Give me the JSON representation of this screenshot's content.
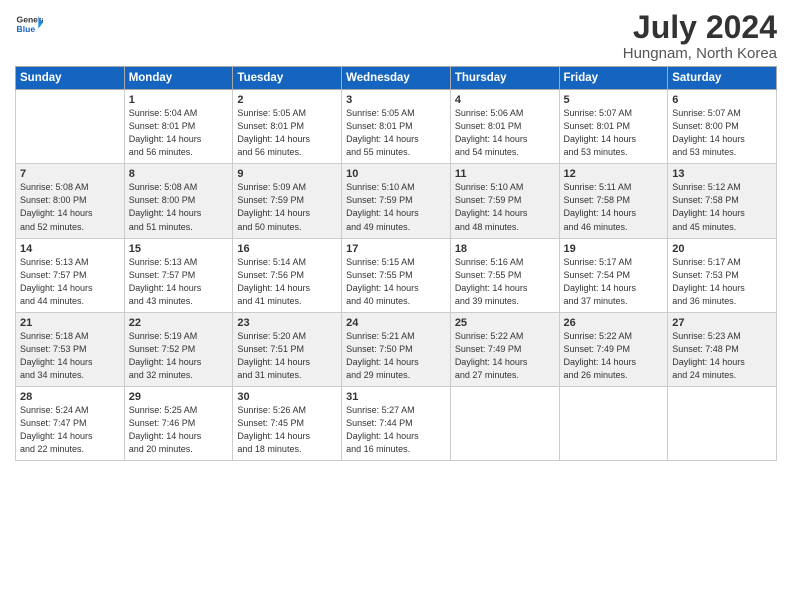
{
  "header": {
    "logo_general": "General",
    "logo_blue": "Blue",
    "title": "July 2024",
    "subtitle": "Hungnam, North Korea"
  },
  "days_of_week": [
    "Sunday",
    "Monday",
    "Tuesday",
    "Wednesday",
    "Thursday",
    "Friday",
    "Saturday"
  ],
  "weeks": [
    [
      {
        "day": "",
        "info": ""
      },
      {
        "day": "1",
        "info": "Sunrise: 5:04 AM\nSunset: 8:01 PM\nDaylight: 14 hours\nand 56 minutes."
      },
      {
        "day": "2",
        "info": "Sunrise: 5:05 AM\nSunset: 8:01 PM\nDaylight: 14 hours\nand 56 minutes."
      },
      {
        "day": "3",
        "info": "Sunrise: 5:05 AM\nSunset: 8:01 PM\nDaylight: 14 hours\nand 55 minutes."
      },
      {
        "day": "4",
        "info": "Sunrise: 5:06 AM\nSunset: 8:01 PM\nDaylight: 14 hours\nand 54 minutes."
      },
      {
        "day": "5",
        "info": "Sunrise: 5:07 AM\nSunset: 8:01 PM\nDaylight: 14 hours\nand 53 minutes."
      },
      {
        "day": "6",
        "info": "Sunrise: 5:07 AM\nSunset: 8:00 PM\nDaylight: 14 hours\nand 53 minutes."
      }
    ],
    [
      {
        "day": "7",
        "info": "Sunrise: 5:08 AM\nSunset: 8:00 PM\nDaylight: 14 hours\nand 52 minutes."
      },
      {
        "day": "8",
        "info": "Sunrise: 5:08 AM\nSunset: 8:00 PM\nDaylight: 14 hours\nand 51 minutes."
      },
      {
        "day": "9",
        "info": "Sunrise: 5:09 AM\nSunset: 7:59 PM\nDaylight: 14 hours\nand 50 minutes."
      },
      {
        "day": "10",
        "info": "Sunrise: 5:10 AM\nSunset: 7:59 PM\nDaylight: 14 hours\nand 49 minutes."
      },
      {
        "day": "11",
        "info": "Sunrise: 5:10 AM\nSunset: 7:59 PM\nDaylight: 14 hours\nand 48 minutes."
      },
      {
        "day": "12",
        "info": "Sunrise: 5:11 AM\nSunset: 7:58 PM\nDaylight: 14 hours\nand 46 minutes."
      },
      {
        "day": "13",
        "info": "Sunrise: 5:12 AM\nSunset: 7:58 PM\nDaylight: 14 hours\nand 45 minutes."
      }
    ],
    [
      {
        "day": "14",
        "info": "Sunrise: 5:13 AM\nSunset: 7:57 PM\nDaylight: 14 hours\nand 44 minutes."
      },
      {
        "day": "15",
        "info": "Sunrise: 5:13 AM\nSunset: 7:57 PM\nDaylight: 14 hours\nand 43 minutes."
      },
      {
        "day": "16",
        "info": "Sunrise: 5:14 AM\nSunset: 7:56 PM\nDaylight: 14 hours\nand 41 minutes."
      },
      {
        "day": "17",
        "info": "Sunrise: 5:15 AM\nSunset: 7:55 PM\nDaylight: 14 hours\nand 40 minutes."
      },
      {
        "day": "18",
        "info": "Sunrise: 5:16 AM\nSunset: 7:55 PM\nDaylight: 14 hours\nand 39 minutes."
      },
      {
        "day": "19",
        "info": "Sunrise: 5:17 AM\nSunset: 7:54 PM\nDaylight: 14 hours\nand 37 minutes."
      },
      {
        "day": "20",
        "info": "Sunrise: 5:17 AM\nSunset: 7:53 PM\nDaylight: 14 hours\nand 36 minutes."
      }
    ],
    [
      {
        "day": "21",
        "info": "Sunrise: 5:18 AM\nSunset: 7:53 PM\nDaylight: 14 hours\nand 34 minutes."
      },
      {
        "day": "22",
        "info": "Sunrise: 5:19 AM\nSunset: 7:52 PM\nDaylight: 14 hours\nand 32 minutes."
      },
      {
        "day": "23",
        "info": "Sunrise: 5:20 AM\nSunset: 7:51 PM\nDaylight: 14 hours\nand 31 minutes."
      },
      {
        "day": "24",
        "info": "Sunrise: 5:21 AM\nSunset: 7:50 PM\nDaylight: 14 hours\nand 29 minutes."
      },
      {
        "day": "25",
        "info": "Sunrise: 5:22 AM\nSunset: 7:49 PM\nDaylight: 14 hours\nand 27 minutes."
      },
      {
        "day": "26",
        "info": "Sunrise: 5:22 AM\nSunset: 7:49 PM\nDaylight: 14 hours\nand 26 minutes."
      },
      {
        "day": "27",
        "info": "Sunrise: 5:23 AM\nSunset: 7:48 PM\nDaylight: 14 hours\nand 24 minutes."
      }
    ],
    [
      {
        "day": "28",
        "info": "Sunrise: 5:24 AM\nSunset: 7:47 PM\nDaylight: 14 hours\nand 22 minutes."
      },
      {
        "day": "29",
        "info": "Sunrise: 5:25 AM\nSunset: 7:46 PM\nDaylight: 14 hours\nand 20 minutes."
      },
      {
        "day": "30",
        "info": "Sunrise: 5:26 AM\nSunset: 7:45 PM\nDaylight: 14 hours\nand 18 minutes."
      },
      {
        "day": "31",
        "info": "Sunrise: 5:27 AM\nSunset: 7:44 PM\nDaylight: 14 hours\nand 16 minutes."
      },
      {
        "day": "",
        "info": ""
      },
      {
        "day": "",
        "info": ""
      },
      {
        "day": "",
        "info": ""
      }
    ]
  ]
}
